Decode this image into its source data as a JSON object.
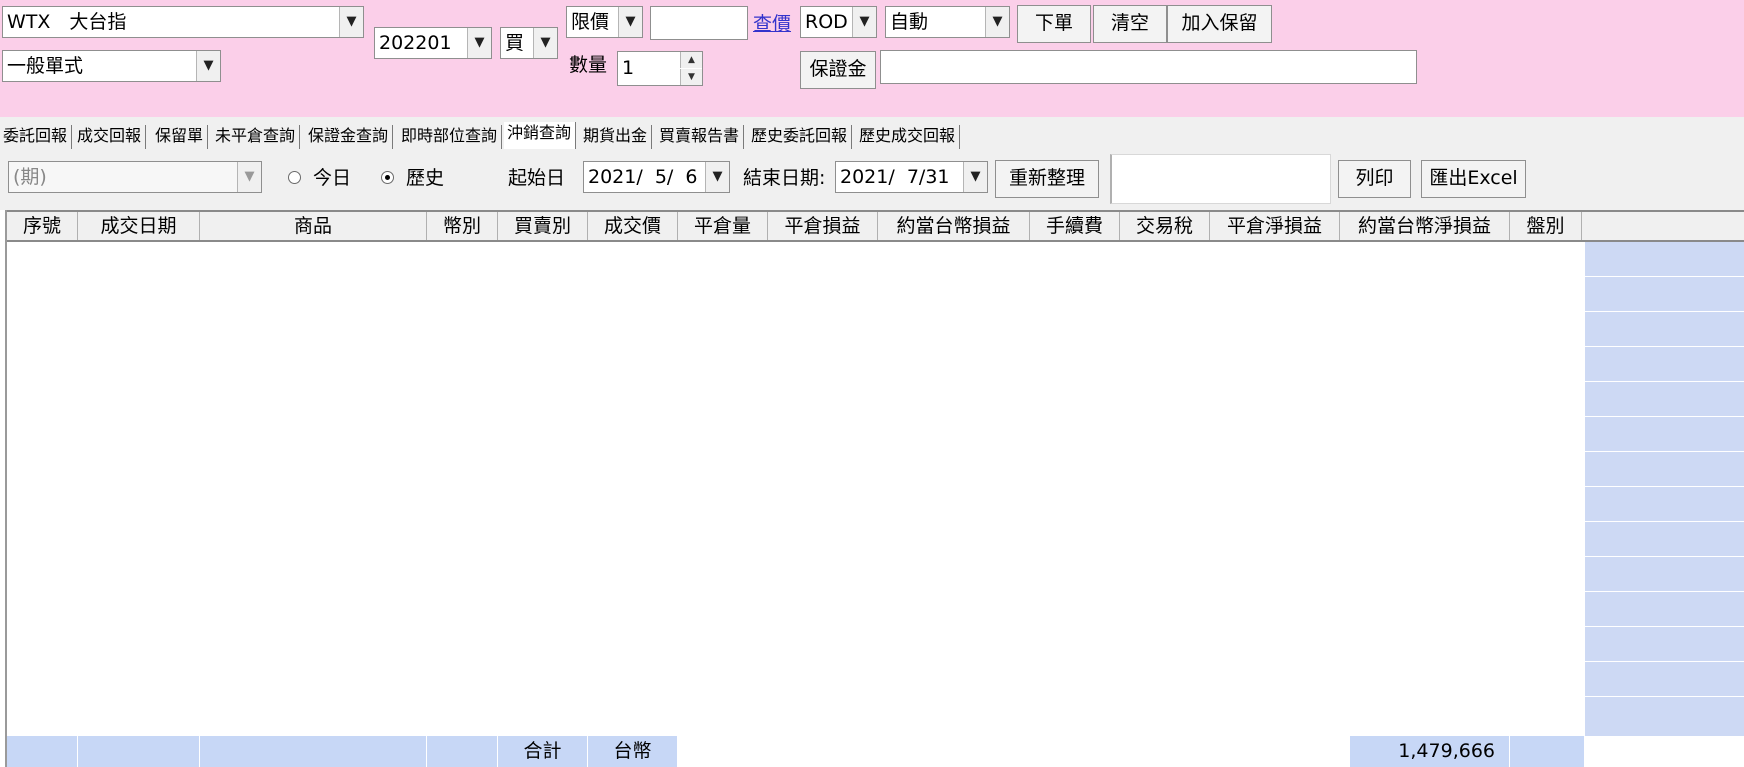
{
  "order": {
    "product_value": "WTX　大台指",
    "order_type_value": "一般單式",
    "month_value": "202201",
    "side_value": "買",
    "price_type_value": "限價",
    "price_value": "",
    "price_lookup_label": "查價",
    "quantity_label": "數量",
    "quantity_value": "1",
    "time_in_force_value": "ROD",
    "open_close_value": "自動",
    "place_order_label": "下單",
    "clear_label": "清空",
    "add_reserve_label": "加入保留",
    "margin_label": "保證金",
    "margin_value": ""
  },
  "tabs": [
    {
      "label": "委託回報"
    },
    {
      "label": "成交回報"
    },
    {
      "label": "保留單"
    },
    {
      "label": "未平倉查詢"
    },
    {
      "label": "保證金查詢"
    },
    {
      "label": "即時部位查詢"
    },
    {
      "label": "沖銷查詢",
      "active": true
    },
    {
      "label": "期貨出金"
    },
    {
      "label": "買賣報告書"
    },
    {
      "label": "歷史委託回報"
    },
    {
      "label": "歷史成交回報"
    }
  ],
  "filter": {
    "category_placeholder": "(期)",
    "radio_today_label": "今日",
    "radio_history_label": "歷史",
    "selected_radio": "歷史",
    "start_date_label": "起始日",
    "start_date_value": "2021/  5/  6",
    "end_date_label": "結束日期:",
    "end_date_value": "2021/  7/31",
    "refresh_label": "重新整理",
    "print_label": "列印",
    "export_excel_label": "匯出Excel"
  },
  "table": {
    "columns": [
      "序號",
      "成交日期",
      "商品",
      "幣別",
      "買賣別",
      "成交價",
      "平倉量",
      "平倉損益",
      "約當台幣損益",
      "手續費",
      "交易稅",
      "平倉淨損益",
      "約當台幣淨損益",
      "盤別"
    ],
    "rows": [],
    "footer": {
      "total_label": "合計",
      "currency_label": "台幣",
      "net_pl_twd": "1,479,666"
    }
  },
  "colors": {
    "order_panel_bg": "#fbcfe9",
    "footer_blue": "#c7d7f6",
    "stripe_blue": "#cdd9f4",
    "link": "#3333cc"
  }
}
